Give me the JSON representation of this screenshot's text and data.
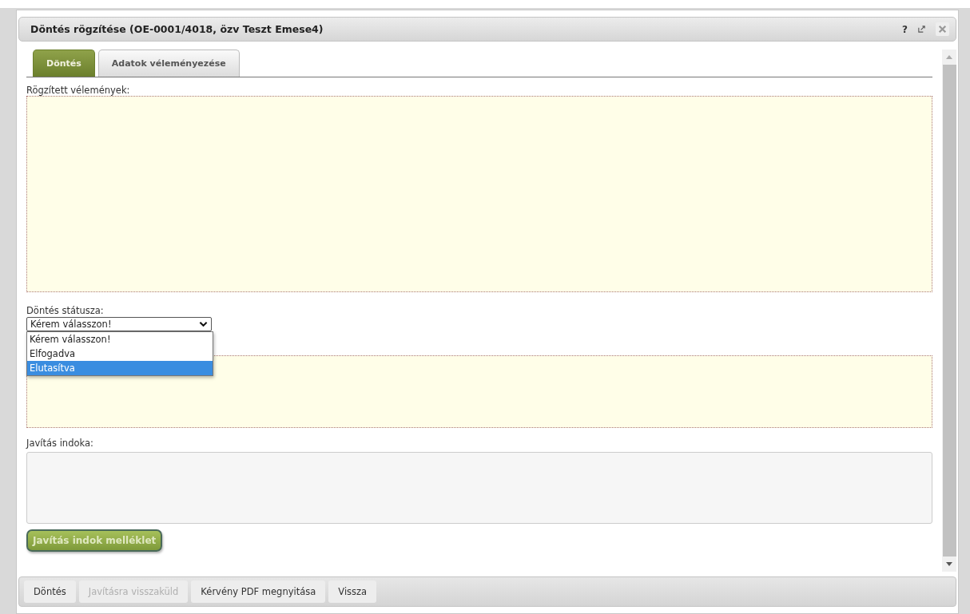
{
  "window": {
    "title": "Döntés rögzítése (OE-0001/4018, özv Teszt Emese4)",
    "controls": [
      {
        "kind": "help",
        "label": "?"
      },
      {
        "kind": "popout"
      },
      {
        "kind": "close"
      }
    ]
  },
  "tabs": [
    {
      "label": "Döntés",
      "selected": true
    },
    {
      "label": "Adatok véleményezése",
      "selected": false
    }
  ],
  "opinions": {
    "label": "Rögzített vélemények:"
  },
  "status": {
    "label": "Döntés státusza:",
    "value": "Kérem válasszon!",
    "expanded": true,
    "options": [
      {
        "label": "Kérem válasszon!",
        "highlighted": false
      },
      {
        "label": "Elfogadva",
        "highlighted": false
      },
      {
        "label": "Elutasítva",
        "highlighted": true
      }
    ]
  },
  "reason": {
    "label": "Javítás indoka:"
  },
  "attachment_button": "Javítás indok melléklet",
  "footer_buttons": [
    {
      "label": "Döntés",
      "disabled": false
    },
    {
      "label": "Javításra visszaküld",
      "disabled": true
    },
    {
      "label": "Kérvény PDF megnyitása",
      "disabled": false
    },
    {
      "label": "Vissza",
      "disabled": false
    }
  ]
}
